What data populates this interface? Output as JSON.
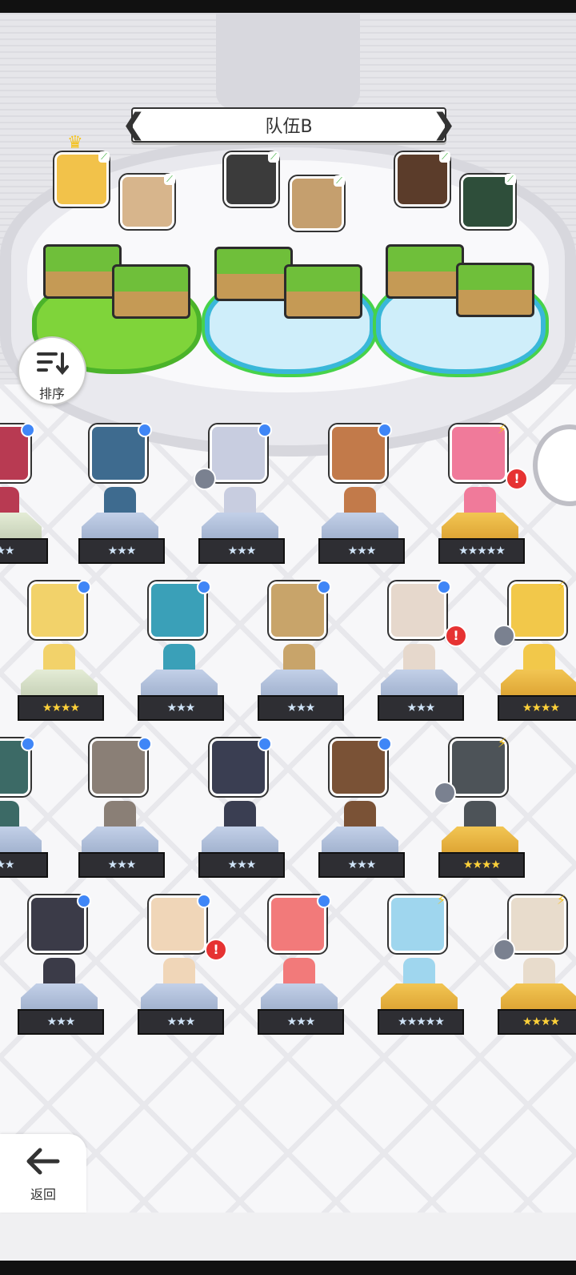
{
  "team": {
    "title": "队伍B"
  },
  "sort": {
    "label": "排序"
  },
  "back": {
    "label": "返回"
  },
  "colors": {
    "leaf_tag": "#2eaa2e",
    "level_dot": "#3f86f7",
    "alert": "#e63232",
    "gold_star": "#ffd13a"
  },
  "team_members": [
    {
      "name_icon": "hero-portrait",
      "color": "#f2c24a",
      "leader": true
    },
    {
      "name_icon": "hero-portrait",
      "color": "#d7b58c"
    },
    {
      "name_icon": "hero-portrait",
      "color": "#3b3b3b"
    },
    {
      "name_icon": "hero-portrait",
      "color": "#c59f6e"
    },
    {
      "name_icon": "hero-portrait",
      "color": "#5b3c2a"
    },
    {
      "name_icon": "hero-portrait",
      "color": "#2e4e3a"
    }
  ],
  "roster": [
    {
      "stars": "★★",
      "tier": "pale",
      "badge": "dot",
      "color": "#b83a52"
    },
    {
      "stars": "★★★",
      "tier": "silver",
      "badge": "dot",
      "color": "#3e6b8f"
    },
    {
      "stars": "★★★",
      "tier": "silver",
      "badge": "dot",
      "gem": true,
      "color": "#c8cde0"
    },
    {
      "stars": "★★★",
      "tier": "silver",
      "badge": "dot",
      "color": "#c27a4a"
    },
    {
      "stars": "★★★★★",
      "tier": "gold",
      "badge": "bolt",
      "alert": true,
      "color": "#f07a9a"
    },
    {
      "stars": "★★★★",
      "tier": "pale",
      "badge": "dot",
      "color": "#f2d26a",
      "gold": true
    },
    {
      "stars": "★★★",
      "tier": "silver",
      "badge": "dot",
      "color": "#3aa0b8"
    },
    {
      "stars": "★★★",
      "tier": "silver",
      "badge": "dot",
      "color": "#c8a46a"
    },
    {
      "stars": "★★★",
      "tier": "silver",
      "badge": "dot",
      "alert": true,
      "color": "#e6d8cc"
    },
    {
      "stars": "★★★★",
      "tier": "gold",
      "badge": "bolt",
      "gem": true,
      "color": "#f2c84a",
      "gold": true
    },
    {
      "stars": "★★",
      "tier": "silver",
      "badge": "dot",
      "color": "#3c6a66"
    },
    {
      "stars": "★★★",
      "tier": "silver",
      "badge": "dot",
      "color": "#8a7f76"
    },
    {
      "stars": "★★★",
      "tier": "silver",
      "badge": "dot",
      "color": "#3a3e52"
    },
    {
      "stars": "★★★",
      "tier": "silver",
      "badge": "dot",
      "color": "#7a5236"
    },
    {
      "stars": "★★★★",
      "tier": "gold",
      "badge": "bolt",
      "gem": true,
      "color": "#4d5358",
      "gold": true
    },
    {
      "stars": "★★★",
      "tier": "silver",
      "badge": "dot",
      "color": "#3b3b48"
    },
    {
      "stars": "★★★",
      "tier": "silver",
      "badge": "dot",
      "alert": true,
      "color": "#f0d6b8"
    },
    {
      "stars": "★★★",
      "tier": "silver",
      "badge": "dot",
      "color": "#f27a7a"
    },
    {
      "stars": "★★★★★",
      "tier": "gold",
      "badge": "bolt",
      "color": "#9fd6ee"
    },
    {
      "stars": "★★★★",
      "tier": "gold",
      "badge": "bolt",
      "gem": true,
      "color": "#e8dccc",
      "gold": true
    }
  ]
}
